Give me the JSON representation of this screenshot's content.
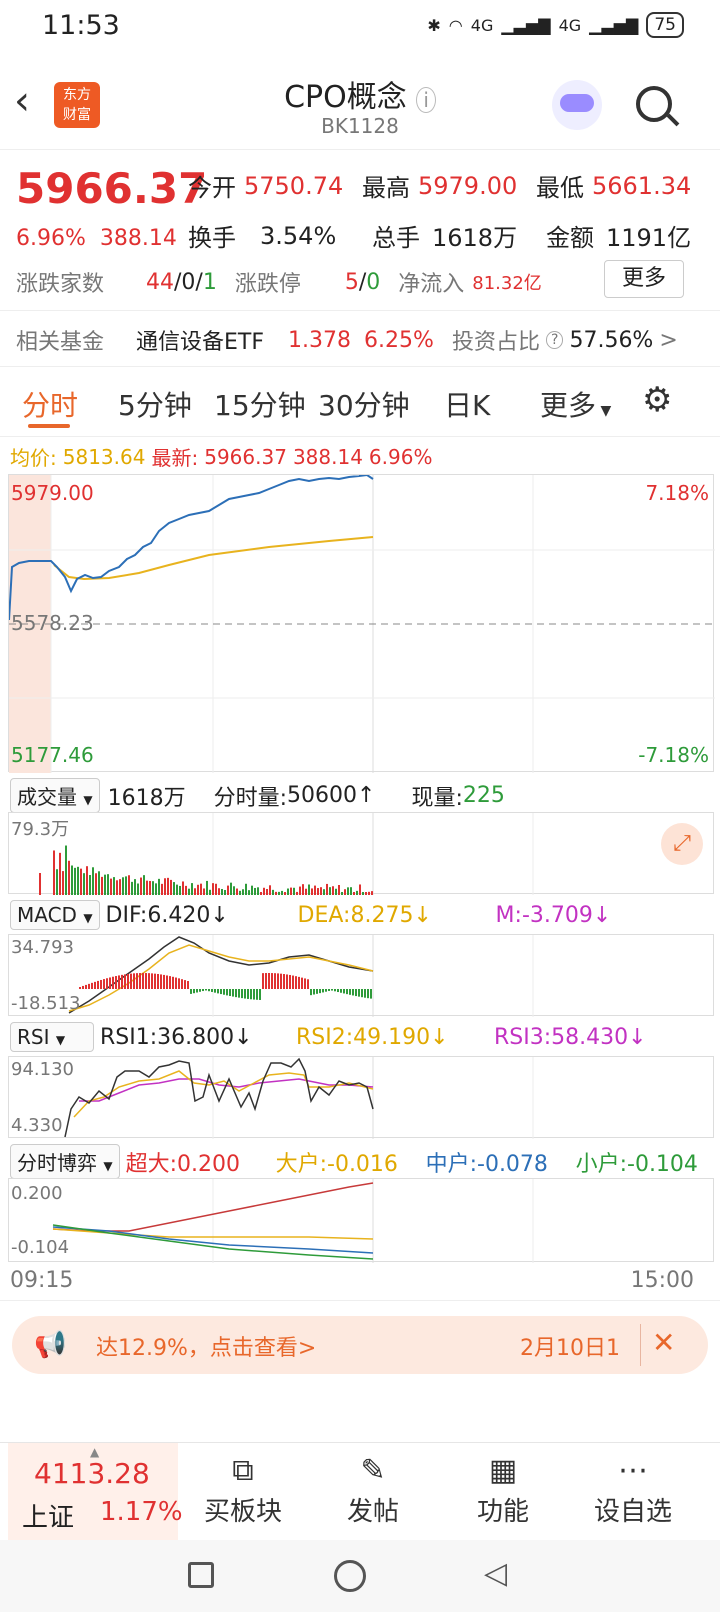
{
  "status": {
    "time": "11:53",
    "net1": "4G",
    "net2": "4G",
    "battery": "75"
  },
  "header": {
    "logo_line1": "东方",
    "logo_line2": "财富",
    "title": "CPO概念",
    "code": "BK1128"
  },
  "quote": {
    "price": "5966.37",
    "pct": "6.96%",
    "chg": "388.14",
    "open_label": "今开",
    "open": "5750.74",
    "high_label": "最高",
    "high": "5979.00",
    "low_label": "最低",
    "low": "5661.34",
    "turn_label": "换手",
    "turn": "3.54%",
    "vol_label": "总手",
    "vol": "1618万",
    "amt_label": "金额",
    "amt": "1191亿",
    "breadth_label": "涨跌家数",
    "breadth_up": "44",
    "breadth_flat": "0",
    "breadth_down": "1",
    "limit_label": "涨跌停",
    "limit_up": "5",
    "limit_down": "0",
    "inflow_label": "净流入",
    "inflow": "81.32亿",
    "more": "更多"
  },
  "fund": {
    "label": "相关基金",
    "name": "通信设备ETF",
    "price": "1.378",
    "pct": "6.25%",
    "ratio_label": "投资占比",
    "ratio": "57.56%"
  },
  "tabs": [
    "分时",
    "5分钟",
    "15分钟",
    "30分钟",
    "日K",
    "更多"
  ],
  "info": {
    "avg_label": "均价:",
    "avg": "5813.64",
    "last_label": "最新:",
    "last": "5966.37",
    "chg": "388.14",
    "pct": "6.96%"
  },
  "main": {
    "top": "5979.00",
    "mid": "5578.23",
    "bottom": "5177.46",
    "top_pct": "7.18%",
    "bot_pct": "-7.18%"
  },
  "volume": {
    "label": "成交量",
    "total": "1618万",
    "tick_label": "分时量:",
    "tick": "50600",
    "cur_label": "现量:",
    "cur": "225",
    "max": "79.3万"
  },
  "macd": {
    "label": "MACD",
    "dif": "DIF:6.420",
    "dea": "DEA:8.275",
    "m": "M:-3.709",
    "hi": "34.793",
    "lo": "-18.513"
  },
  "rsi": {
    "label": "RSI",
    "r1": "RSI1:36.800",
    "r2": "RSI2:49.190",
    "r3": "RSI3:58.430",
    "hi": "94.130",
    "lo": "4.330"
  },
  "game": {
    "label": "分时博弈",
    "big": "超大:0.200",
    "large": "大户:-0.016",
    "mid": "中户:-0.078",
    "small": "小户:-0.104",
    "hi": "0.200",
    "lo": "-0.104"
  },
  "axis": {
    "start": "09:15",
    "end": "15:00"
  },
  "banner": {
    "text": "达12.9%，点击查看>",
    "date": "2月10日1"
  },
  "index": {
    "value": "4113.28",
    "name": "上证",
    "pct": "1.17%"
  },
  "nav": [
    "买板块",
    "发帖",
    "功能",
    "设自选"
  ]
}
